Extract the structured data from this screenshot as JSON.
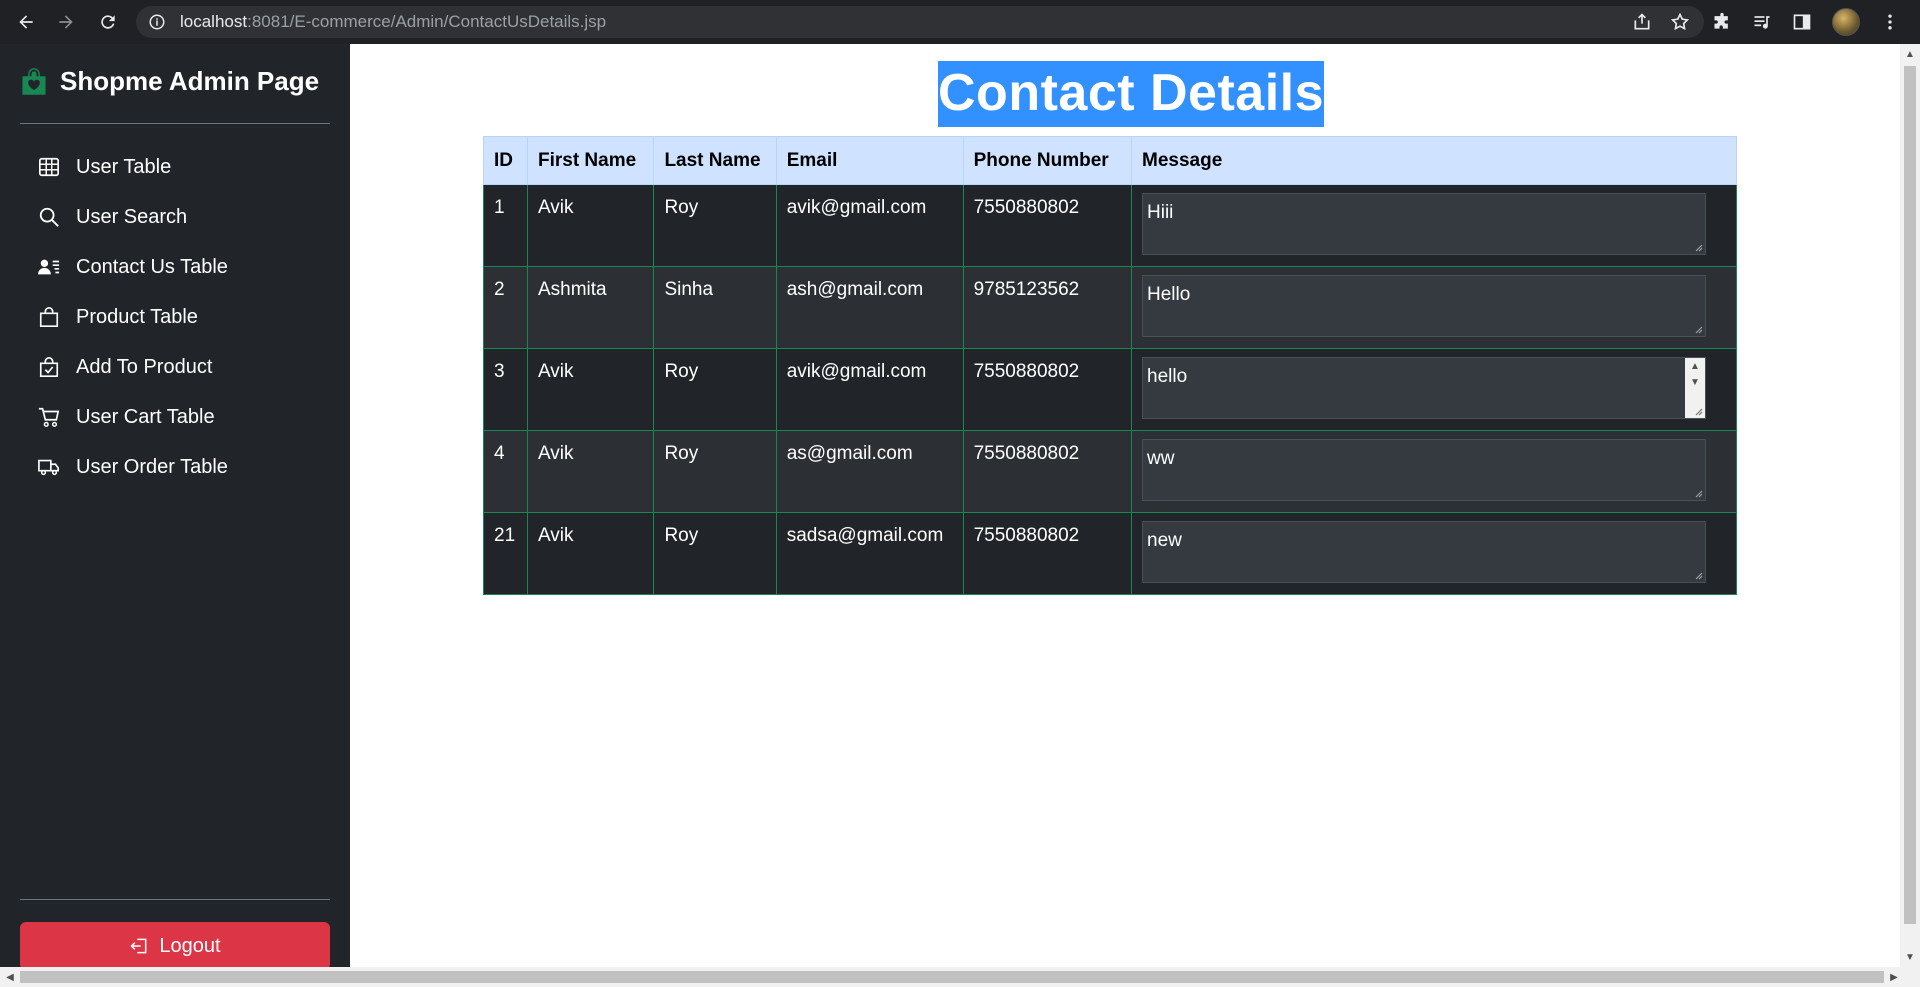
{
  "browser": {
    "url_host": "localhost",
    "url_path": ":8081/E-commerce/Admin/ContactUsDetails.jsp"
  },
  "sidebar": {
    "brand": "Shopme Admin Page",
    "items": [
      {
        "label": "User Table",
        "icon": "table-icon"
      },
      {
        "label": "User Search",
        "icon": "search-icon"
      },
      {
        "label": "Contact Us Table",
        "icon": "person-lines-icon"
      },
      {
        "label": "Product Table",
        "icon": "bag-icon"
      },
      {
        "label": "Add To Product",
        "icon": "bag-check-icon"
      },
      {
        "label": "User Cart Table",
        "icon": "cart-icon"
      },
      {
        "label": "User Order Table",
        "icon": "truck-icon"
      }
    ],
    "logout_label": "Logout"
  },
  "main": {
    "title": "Contact Details",
    "columns": [
      "ID",
      "First Name",
      "Last Name",
      "Email",
      "Phone Number",
      "Message"
    ],
    "rows": [
      {
        "id": "1",
        "first": "Avik",
        "last": "Roy",
        "email": "avik@gmail.com",
        "phone": "7550880802",
        "message": "Hiii"
      },
      {
        "id": "2",
        "first": "Ashmita",
        "last": "Sinha",
        "email": "ash@gmail.com",
        "phone": "9785123562",
        "message": "Hello"
      },
      {
        "id": "3",
        "first": "Avik",
        "last": "Roy",
        "email": "avik@gmail.com",
        "phone": "7550880802",
        "message": "hello"
      },
      {
        "id": "4",
        "first": "Avik",
        "last": "Roy",
        "email": "as@gmail.com",
        "phone": "7550880802",
        "message": "ww"
      },
      {
        "id": "21",
        "first": "Avik",
        "last": "Roy",
        "email": "sadsa@gmail.com",
        "phone": "7550880802",
        "message": "new"
      }
    ]
  },
  "colors": {
    "sidebar_bg": "#212529",
    "logout_bg": "#dc3545",
    "brand_icon": "#198754",
    "header_bg": "#cfe2ff",
    "title_highlight": "#3390ff"
  }
}
